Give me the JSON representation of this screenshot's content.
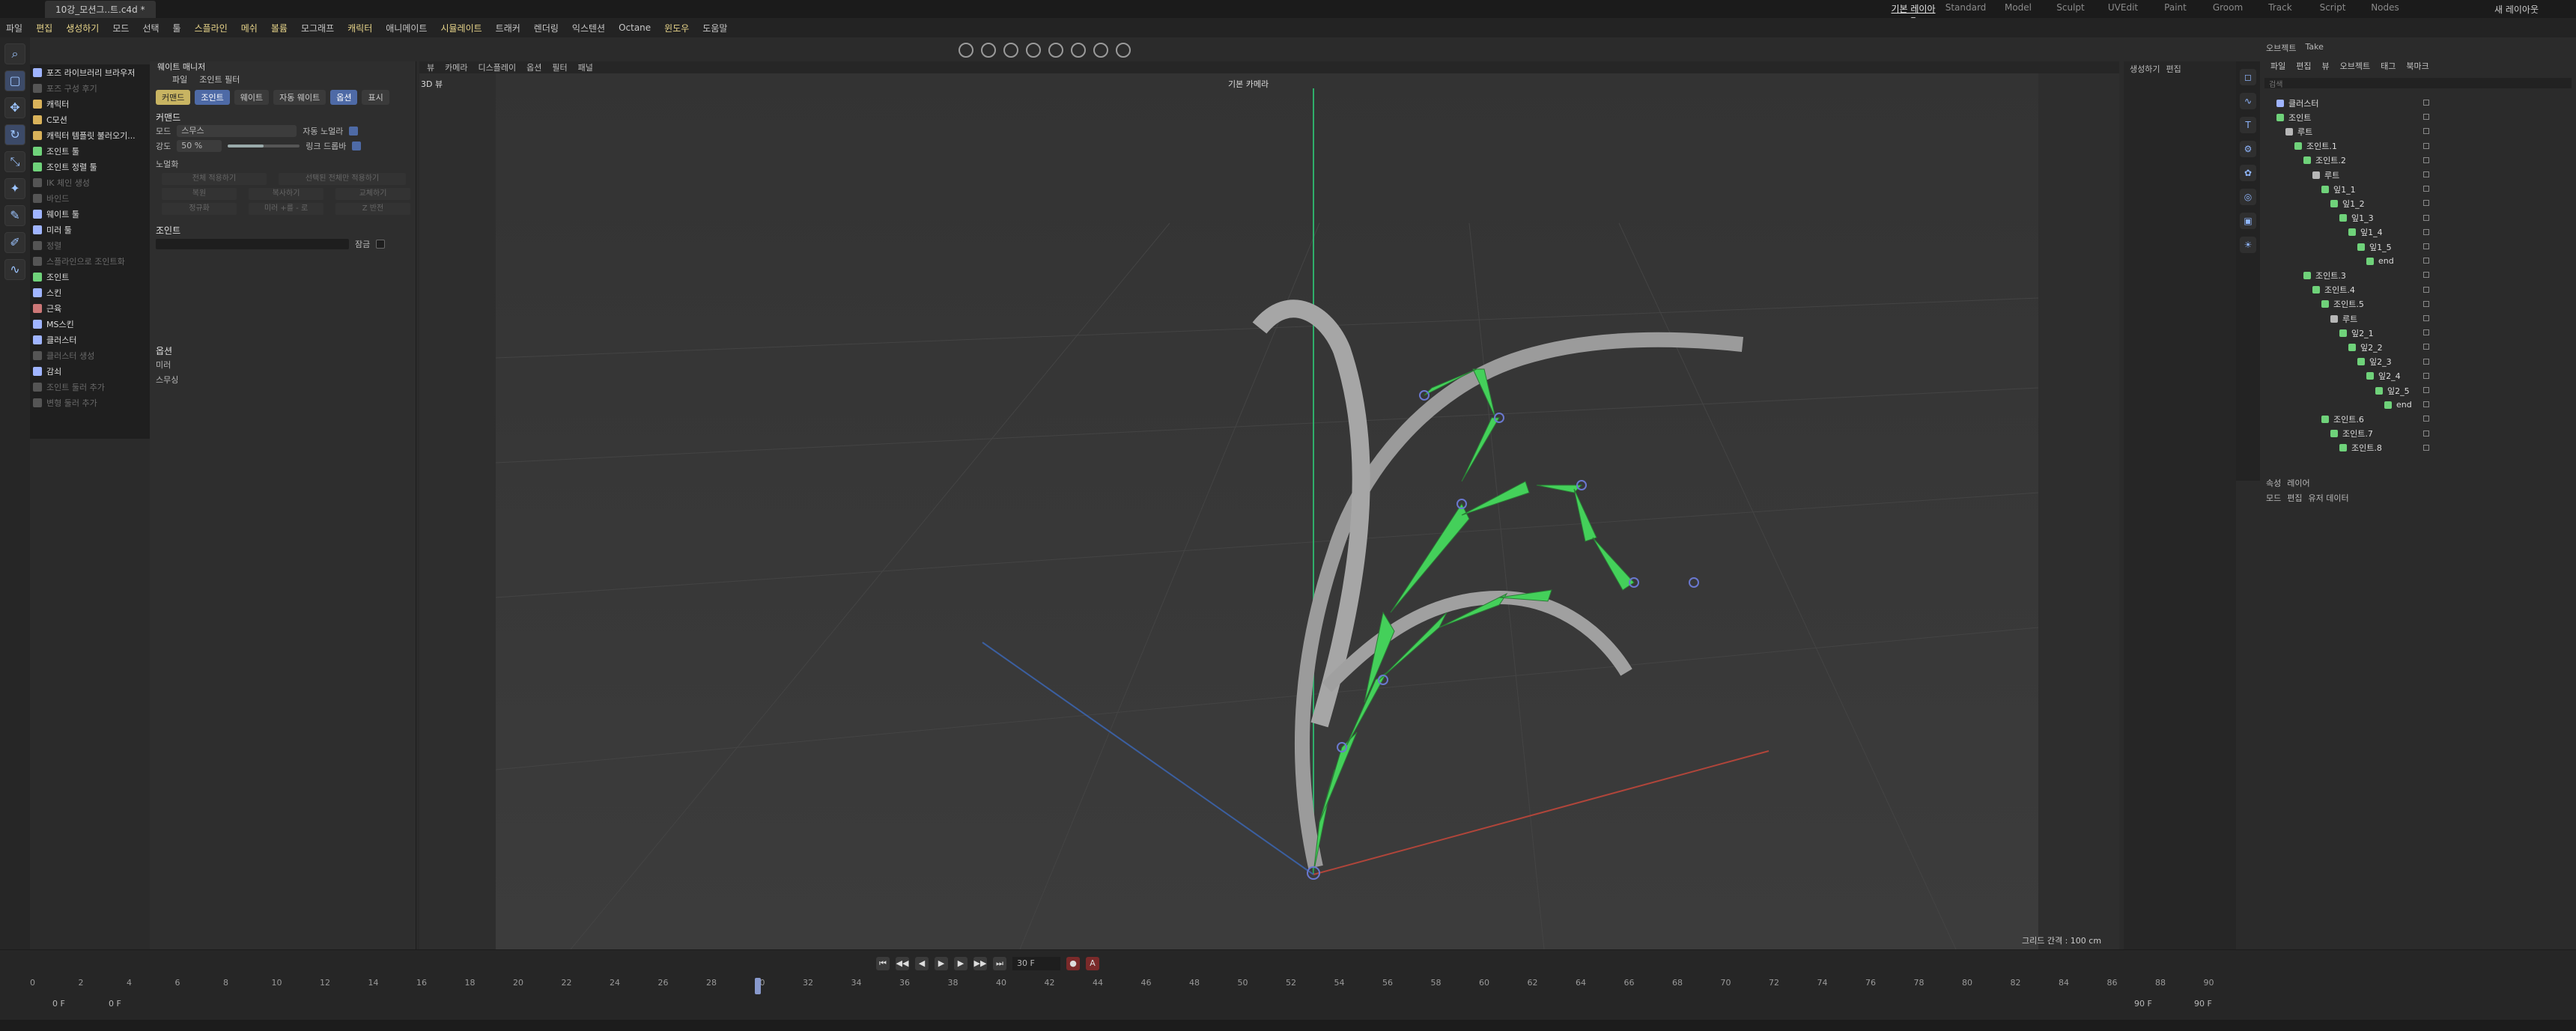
{
  "window": {
    "tab_title": "10강_모션그..트.c4d *"
  },
  "layouts": [
    "기본 레이아웃",
    "Standard",
    "Model",
    "Sculpt",
    "UVEdit",
    "Paint",
    "Groom",
    "Track",
    "Script",
    "Nodes"
  ],
  "new_layout": "새 레이아웃",
  "menubar": [
    "파일",
    "편집",
    "생성하기",
    "모드",
    "선택",
    "툴",
    "스플라인",
    "메쉬",
    "볼륨",
    "모그래프",
    "캐릭터",
    "애니메이트",
    "시뮬레이트",
    "트래커",
    "렌더링",
    "익스텐션",
    "Octane",
    "윈도우",
    "도움말"
  ],
  "tool_palette": [
    {
      "label": "포즈 라이브러리 브라우저",
      "dim": false,
      "color": "#9fb4ff"
    },
    {
      "label": "포즈 구성 후기",
      "dim": true,
      "color": "#555"
    },
    {
      "label": "캐릭터",
      "dim": false,
      "color": "#d9b25a"
    },
    {
      "label": "C모션",
      "dim": false,
      "color": "#d9b25a"
    },
    {
      "label": "캐릭터 템플릿 불러오기...",
      "dim": false,
      "color": "#d9b25a"
    },
    {
      "label": "조인트 툴",
      "dim": false,
      "color": "#6fd27a"
    },
    {
      "label": "조인트 정렬 툴",
      "dim": false,
      "color": "#6fd27a"
    },
    {
      "label": "IK 체인 생성",
      "dim": true,
      "color": "#555"
    },
    {
      "label": "바인드",
      "dim": true,
      "color": "#555"
    },
    {
      "label": "웨이트 툴",
      "dim": false,
      "color": "#9fb4ff"
    },
    {
      "label": "미러 툴",
      "dim": false,
      "color": "#9fb4ff"
    },
    {
      "label": "정렬",
      "dim": true,
      "color": "#555"
    },
    {
      "label": "스플라인으로 조인트화",
      "dim": true,
      "color": "#555"
    },
    {
      "label": "조인트",
      "dim": false,
      "color": "#6fd27a"
    },
    {
      "label": "스킨",
      "dim": false,
      "color": "#9fb4ff"
    },
    {
      "label": "근육",
      "dim": false,
      "color": "#c77"
    },
    {
      "label": "MS스킨",
      "dim": false,
      "color": "#9fb4ff"
    },
    {
      "label": "클러스터",
      "dim": false,
      "color": "#9fb4ff"
    },
    {
      "label": "클러스터 생성",
      "dim": true,
      "color": "#555"
    },
    {
      "label": "감쇠",
      "dim": false,
      "color": "#9fb4ff"
    },
    {
      "label": "조인트 둘러 추가",
      "dim": true,
      "color": "#555"
    },
    {
      "label": "변형 둘러 추가",
      "dim": true,
      "color": "#555"
    }
  ],
  "weight_manager": {
    "title": "웨이트 매니저",
    "menu": [
      "파일",
      "조인트 필터"
    ],
    "tabs": [
      "커맨드",
      "조인트",
      "웨이트",
      "자동 웨이트",
      "옵션",
      "표시"
    ],
    "command_label": "커맨드",
    "mode_label": "모드",
    "mode_value": "스무스",
    "strength_label": "강도",
    "strength_value": "50 %",
    "strength_fraction": 0.5,
    "auto_normalize": "자동 노멀라",
    "link_drop": "링크 드롭바",
    "section_normalize": "노멀화",
    "btn_all": "전체 적용하기",
    "btn_selected": "선택된 전체만 적용하기",
    "btn_row2": [
      "복원",
      "복사하기",
      "교체하기"
    ],
    "btn_row3": [
      "정규화",
      "미러 +를 - 로",
      "Z 반전"
    ],
    "joint_label": "조인트",
    "lock_label": "잠금",
    "options_label": "옵션",
    "mirror_label": "미러",
    "smooth_label": "스무싱"
  },
  "viewport": {
    "menu": [
      "뷰",
      "카메라",
      "디스플레이",
      "옵션",
      "필터",
      "패널"
    ],
    "name": "3D 뷰",
    "camera": "기본 카메라",
    "grid_label": "그리드 간격 : 100 cm"
  },
  "object_manager": {
    "tabs": [
      "오브젝트",
      "Take"
    ],
    "menu": [
      "파일",
      "편집",
      "뷰",
      "오브젝트",
      "태그",
      "북마크"
    ],
    "search": "검색",
    "items": [
      {
        "label": "클러스터",
        "indent": 0,
        "kind": "root"
      },
      {
        "label": "조인트",
        "indent": 0,
        "kind": "joint"
      },
      {
        "label": "루트",
        "indent": 1,
        "kind": "bone"
      },
      {
        "label": "조인트.1",
        "indent": 2,
        "kind": "joint"
      },
      {
        "label": "조인트.2",
        "indent": 3,
        "kind": "joint"
      },
      {
        "label": "루트",
        "indent": 4,
        "kind": "bone"
      },
      {
        "label": "잎1_1",
        "indent": 5,
        "kind": "joint"
      },
      {
        "label": "잎1_2",
        "indent": 6,
        "kind": "joint"
      },
      {
        "label": "잎1_3",
        "indent": 7,
        "kind": "joint"
      },
      {
        "label": "잎1_4",
        "indent": 8,
        "kind": "joint"
      },
      {
        "label": "잎1_5",
        "indent": 9,
        "kind": "joint"
      },
      {
        "label": "end",
        "indent": 10,
        "kind": "joint"
      },
      {
        "label": "조인트.3",
        "indent": 3,
        "kind": "joint"
      },
      {
        "label": "조인트.4",
        "indent": 4,
        "kind": "joint"
      },
      {
        "label": "조인트.5",
        "indent": 5,
        "kind": "joint"
      },
      {
        "label": "루트",
        "indent": 6,
        "kind": "bone"
      },
      {
        "label": "잎2_1",
        "indent": 7,
        "kind": "joint"
      },
      {
        "label": "잎2_2",
        "indent": 8,
        "kind": "joint"
      },
      {
        "label": "잎2_3",
        "indent": 9,
        "kind": "joint"
      },
      {
        "label": "잎2_4",
        "indent": 10,
        "kind": "joint"
      },
      {
        "label": "잎2_5",
        "indent": 11,
        "kind": "joint"
      },
      {
        "label": "end",
        "indent": 12,
        "kind": "joint"
      },
      {
        "label": "조인트.6",
        "indent": 5,
        "kind": "joint"
      },
      {
        "label": "조인트.7",
        "indent": 6,
        "kind": "joint"
      },
      {
        "label": "조인트.8",
        "indent": 7,
        "kind": "joint"
      }
    ]
  },
  "right_panel": {
    "title": "생성하기",
    "edit": "편집"
  },
  "attribute_manager": {
    "tabs": [
      "속성",
      "레이어"
    ],
    "menu": [
      "모드",
      "편집",
      "유저 데이터"
    ]
  },
  "timeline": {
    "current_frame": "30 F",
    "start_frame": "0 F",
    "start_frame2": "0 F",
    "end_frame": "90 F",
    "end_frame2": "90 F",
    "ticks": [
      0,
      2,
      4,
      6,
      8,
      10,
      12,
      14,
      16,
      18,
      20,
      22,
      24,
      26,
      28,
      30,
      32,
      34,
      36,
      38,
      40,
      42,
      44,
      46,
      48,
      50,
      52,
      54,
      56,
      58,
      60,
      62,
      64,
      66,
      68,
      70,
      72,
      74,
      76,
      78,
      80,
      82,
      84,
      86,
      88,
      90
    ]
  },
  "colors": {
    "accent": "#4e6aa6",
    "joint": "#44d05a",
    "highlight_menu": "#e8d58a"
  }
}
